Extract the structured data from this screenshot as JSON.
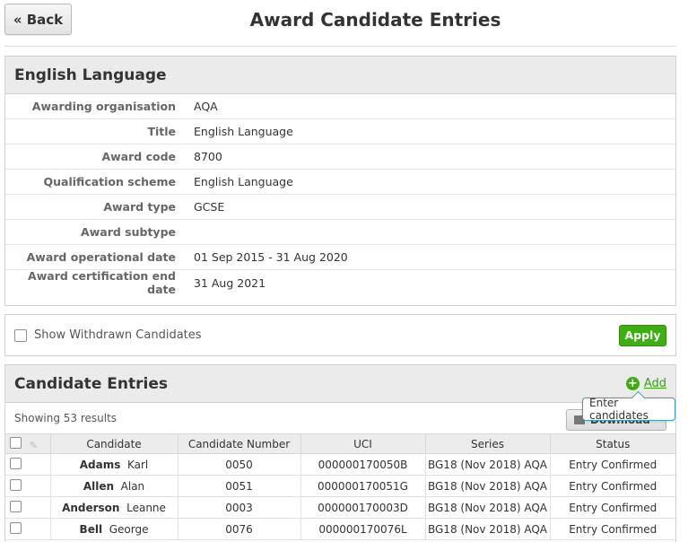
{
  "header": {
    "back_label": "« Back",
    "title": "Award Candidate Entries"
  },
  "award": {
    "heading": "English Language",
    "rows": [
      {
        "label": "Awarding organisation",
        "value": "AQA"
      },
      {
        "label": "Title",
        "value": "English Language"
      },
      {
        "label": "Award code",
        "value": "8700"
      },
      {
        "label": "Qualification scheme",
        "value": "English Language"
      },
      {
        "label": "Award type",
        "value": "GCSE"
      },
      {
        "label": "Award subtype",
        "value": ""
      },
      {
        "label": "Award operational date",
        "value": "01 Sep 2015 - 31 Aug 2020"
      },
      {
        "label": "Award certification end date",
        "value": "31 Aug 2021"
      }
    ]
  },
  "filter": {
    "show_withdrawn_label": "Show Withdrawn Candidates",
    "apply_label": "Apply"
  },
  "entries": {
    "heading": "Candidate Entries",
    "add_label": "Add",
    "tooltip": "Enter candidates",
    "results_text": "Showing 53 results",
    "download_label": "Download",
    "columns": [
      "Candidate",
      "Candidate Number",
      "UCI",
      "Series",
      "Status"
    ],
    "rows": [
      {
        "surname": "Adams",
        "forename": "Karl",
        "number": "0050",
        "uci": "000000170050B",
        "series": "BG18 (Nov 2018) AQA",
        "status": "Entry Confirmed"
      },
      {
        "surname": "Allen",
        "forename": "Alan",
        "number": "0051",
        "uci": "000000170051G",
        "series": "BG18 (Nov 2018) AQA",
        "status": "Entry Confirmed"
      },
      {
        "surname": "Anderson",
        "forename": "Leanne",
        "number": "0003",
        "uci": "000000170003D",
        "series": "BG18 (Nov 2018) AQA",
        "status": "Entry Confirmed"
      },
      {
        "surname": "Bell",
        "forename": "George",
        "number": "0076",
        "uci": "000000170076L",
        "series": "BG18 (Nov 2018) AQA",
        "status": "Entry Confirmed"
      }
    ]
  },
  "colors": {
    "accent_green": "#3eae14",
    "tooltip_border": "#3aa0b8",
    "panel_header": "#ebebeb"
  },
  "icons": {
    "add": "plus-circle-icon",
    "download": "download-icon",
    "edit": "pencil-icon"
  }
}
